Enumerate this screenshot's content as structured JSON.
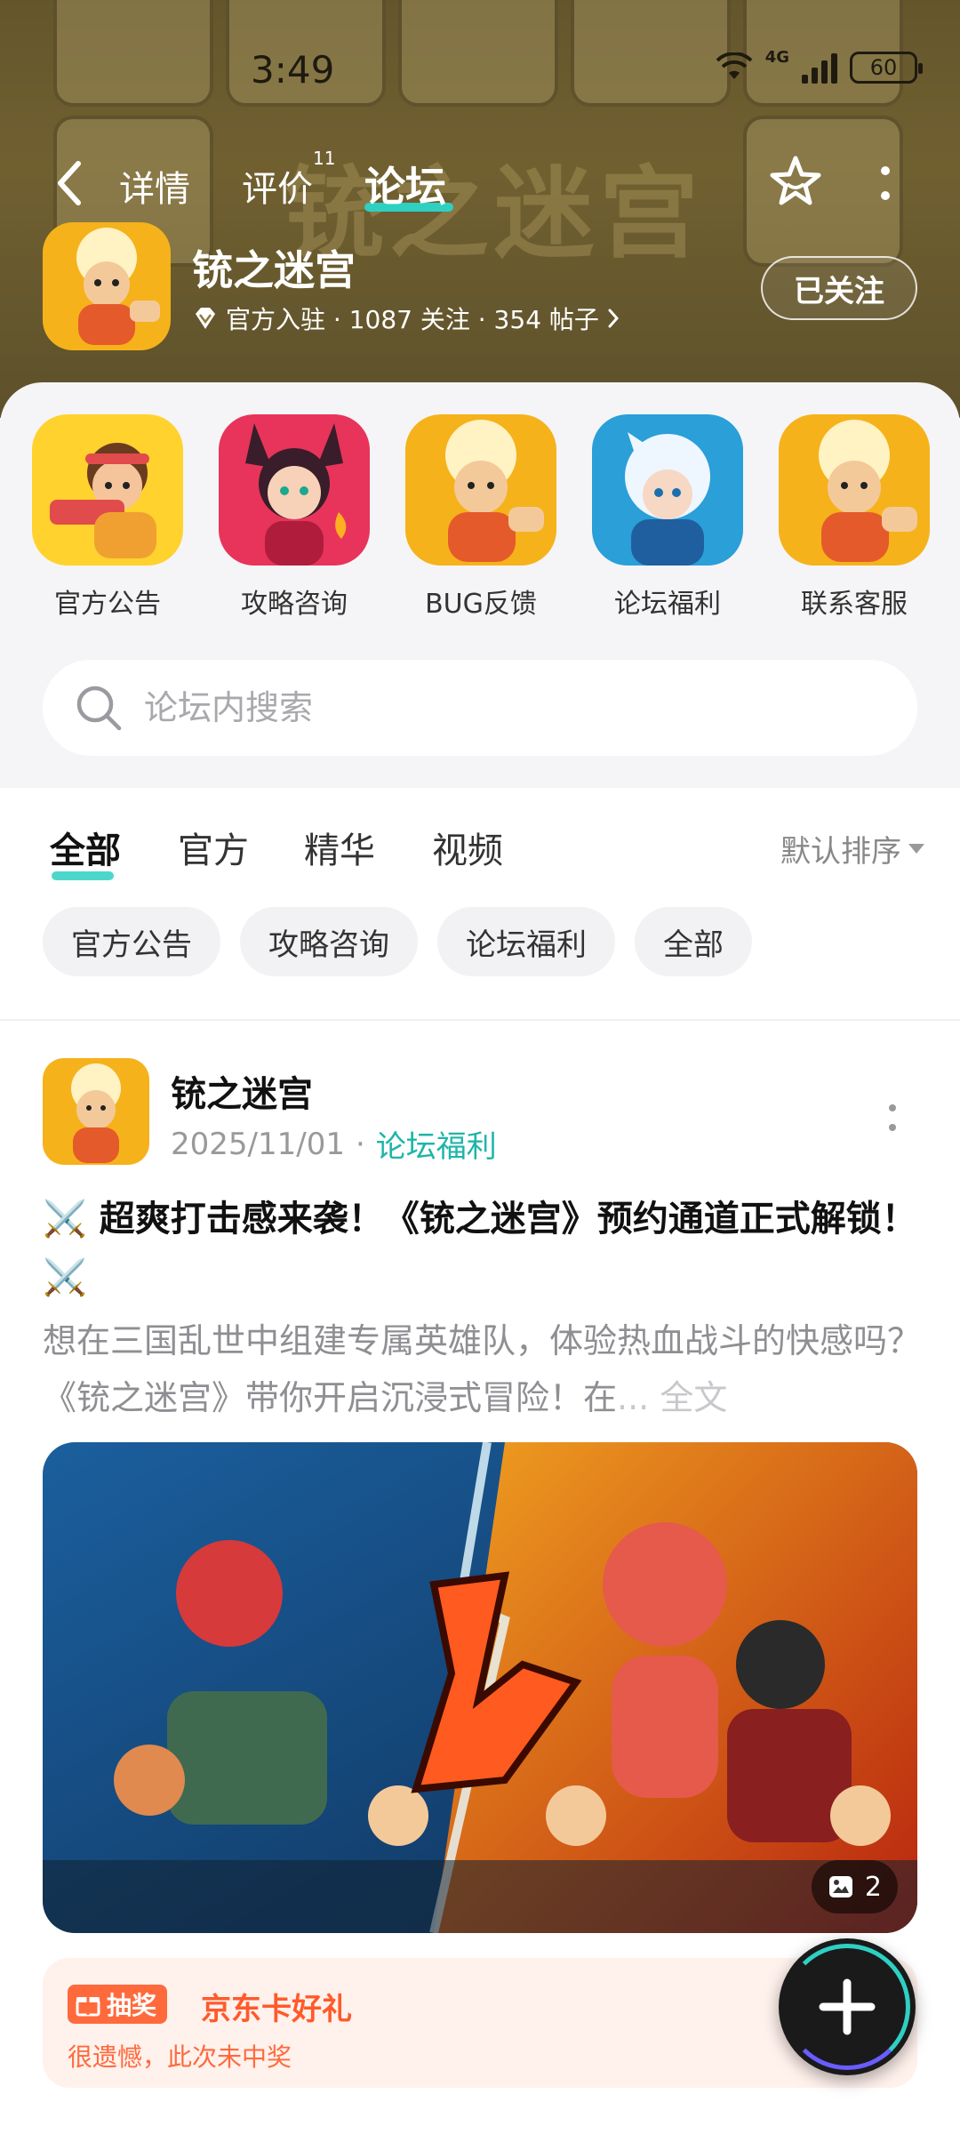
{
  "status_bar": {
    "time": "3:49",
    "network": "4G",
    "battery": "60"
  },
  "nav": {
    "tabs": [
      {
        "label": "详情",
        "active": false
      },
      {
        "label": "评价",
        "badge": "11",
        "active": false
      },
      {
        "label": "论坛",
        "active": true
      }
    ],
    "bg_title": "铳之迷宫"
  },
  "game": {
    "name": "铳之迷宫",
    "meta": "官方入驻 · 1087 关注 · 354 帖子",
    "follow_label": "已关注"
  },
  "shortcuts": [
    {
      "label": "官方公告",
      "icon": "gunner-avatar-icon"
    },
    {
      "label": "攻略咨询",
      "icon": "fox-girl-avatar-icon"
    },
    {
      "label": "BUG反馈",
      "icon": "monk-avatar-icon"
    },
    {
      "label": "论坛福利",
      "icon": "ice-mage-avatar-icon"
    },
    {
      "label": "联系客服",
      "icon": "monk-avatar-icon"
    }
  ],
  "search": {
    "placeholder": "论坛内搜索"
  },
  "filters": {
    "tabs": [
      "全部",
      "官方",
      "精华",
      "视频"
    ],
    "active_tab": "全部",
    "sort_label": "默认排序",
    "chips": [
      "官方公告",
      "攻略咨询",
      "论坛福利",
      "全部"
    ]
  },
  "post": {
    "author": "铳之迷宫",
    "date": "2025/11/01",
    "tag": "论坛福利",
    "title": "⚔️ 超爽打击感来袭！《铳之迷宫》预约通道正式解锁！ ⚔️",
    "body": "想在三国乱世中组建专属英雄队，体验热血战斗的快感吗？《铳之迷宫》带你开启沉浸式冒险！在",
    "ellipsis": "... ",
    "full_text_label": "全文",
    "image_count": "2"
  },
  "lottery": {
    "badge": "抽奖",
    "title": "京东卡好礼",
    "subtitle": "很遗憾，此次未中奖"
  },
  "colors": {
    "accent": "#2ed0c2",
    "tag": "#1fb5a8",
    "lottery": "#ff6a3d"
  }
}
